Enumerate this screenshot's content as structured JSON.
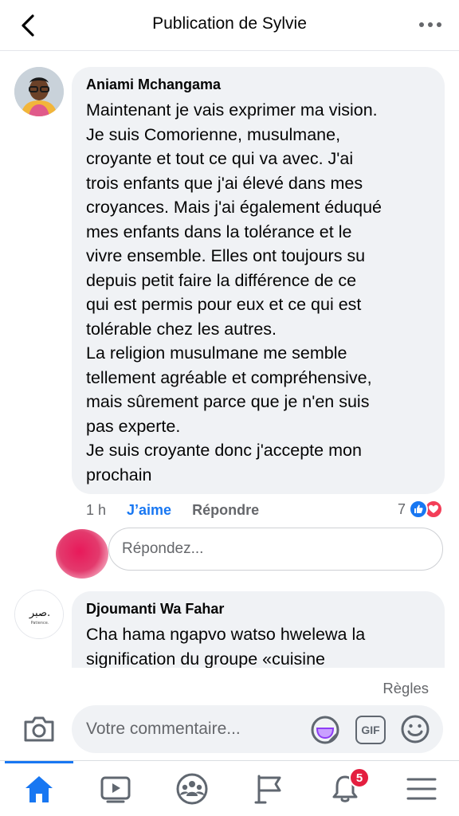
{
  "header": {
    "title": "Publication de Sylvie"
  },
  "comments": [
    {
      "author": "Aniami Mchangama",
      "lines": [
        "Maintenant je vais exprimer ma vision.",
        "Je suis Comorienne, musulmane,",
        "croyante et tout ce qui va avec. J'ai",
        "trois enfants que j'ai élevé dans mes",
        "croyances. Mais j'ai également éduqué",
        "mes enfants dans la tolérance et le",
        "vivre ensemble. Elles ont toujours su",
        "depuis petit faire la différence de ce",
        "qui est permis pour eux et ce qui est",
        "tolérable chez les autres.",
        "La religion musulmane me semble",
        "tellement agréable et compréhensive,",
        "mais sûrement parce que je n'en suis",
        "pas experte.",
        "Je suis croyante donc j'accepte mon",
        "prochain"
      ],
      "time": "1 h",
      "like_label": "J’aime",
      "reply_label": "Répondre",
      "reaction_count": "7"
    },
    {
      "author": "Djoumanti Wa Fahar",
      "lines": [
        "Cha hama ngapvo watso hwelewa la",
        "signification du groupe «cuisine"
      ],
      "avatar_text": "صبر.",
      "avatar_subtext": "Patience."
    }
  ],
  "reply_box": {
    "placeholder": "Répondez..."
  },
  "composer": {
    "rules_label": "Règles",
    "placeholder": "Votre commentaire...",
    "gif_label": "GIF"
  },
  "tabbar": {
    "notifications_badge": "5",
    "items": [
      "home",
      "watch",
      "groups",
      "pages",
      "notifications",
      "menu"
    ]
  },
  "colors": {
    "accent": "#1877f2",
    "bubble": "#f0f2f5",
    "secondary_text": "#65676b",
    "badge": "#e41e3f"
  }
}
